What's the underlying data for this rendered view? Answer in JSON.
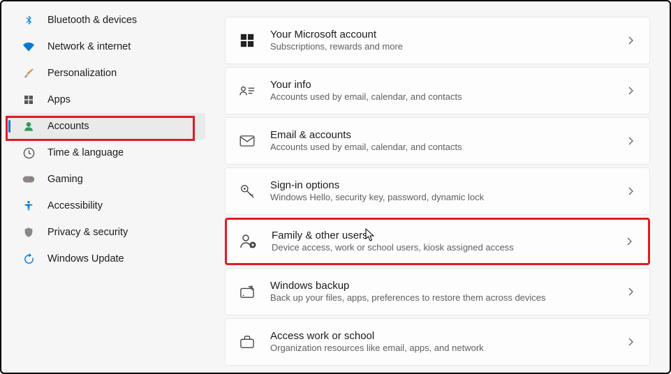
{
  "sidebar": {
    "items": [
      {
        "label": "Bluetooth & devices",
        "icon": "bluetooth",
        "selected": false
      },
      {
        "label": "Network & internet",
        "icon": "network",
        "selected": false
      },
      {
        "label": "Personalization",
        "icon": "personalization",
        "selected": false
      },
      {
        "label": "Apps",
        "icon": "apps",
        "selected": false
      },
      {
        "label": "Accounts",
        "icon": "accounts",
        "selected": true,
        "highlighted": true
      },
      {
        "label": "Time & language",
        "icon": "time",
        "selected": false
      },
      {
        "label": "Gaming",
        "icon": "gaming",
        "selected": false
      },
      {
        "label": "Accessibility",
        "icon": "accessibility",
        "selected": false
      },
      {
        "label": "Privacy & security",
        "icon": "privacy",
        "selected": false
      },
      {
        "label": "Windows Update",
        "icon": "update",
        "selected": false
      }
    ]
  },
  "cards": [
    {
      "title": "Your Microsoft account",
      "desc": "Subscriptions, rewards and more",
      "icon": "microsoft",
      "highlighted": false
    },
    {
      "title": "Your info",
      "desc": "Accounts used by email, calendar, and contacts",
      "icon": "info-card",
      "highlighted": false
    },
    {
      "title": "Email & accounts",
      "desc": "Accounts used by email, calendar, and contacts",
      "icon": "email",
      "highlighted": false
    },
    {
      "title": "Sign-in options",
      "desc": "Windows Hello, security key, password, dynamic lock",
      "icon": "key",
      "highlighted": false
    },
    {
      "title": "Family & other users",
      "desc": "Device access, work or school users, kiosk assigned access",
      "icon": "family",
      "highlighted": true
    },
    {
      "title": "Windows backup",
      "desc": "Back up your files, apps, preferences to restore them across devices",
      "icon": "backup",
      "highlighted": false
    },
    {
      "title": "Access work or school",
      "desc": "Organization resources like email, apps, and network",
      "icon": "briefcase",
      "highlighted": false
    }
  ]
}
